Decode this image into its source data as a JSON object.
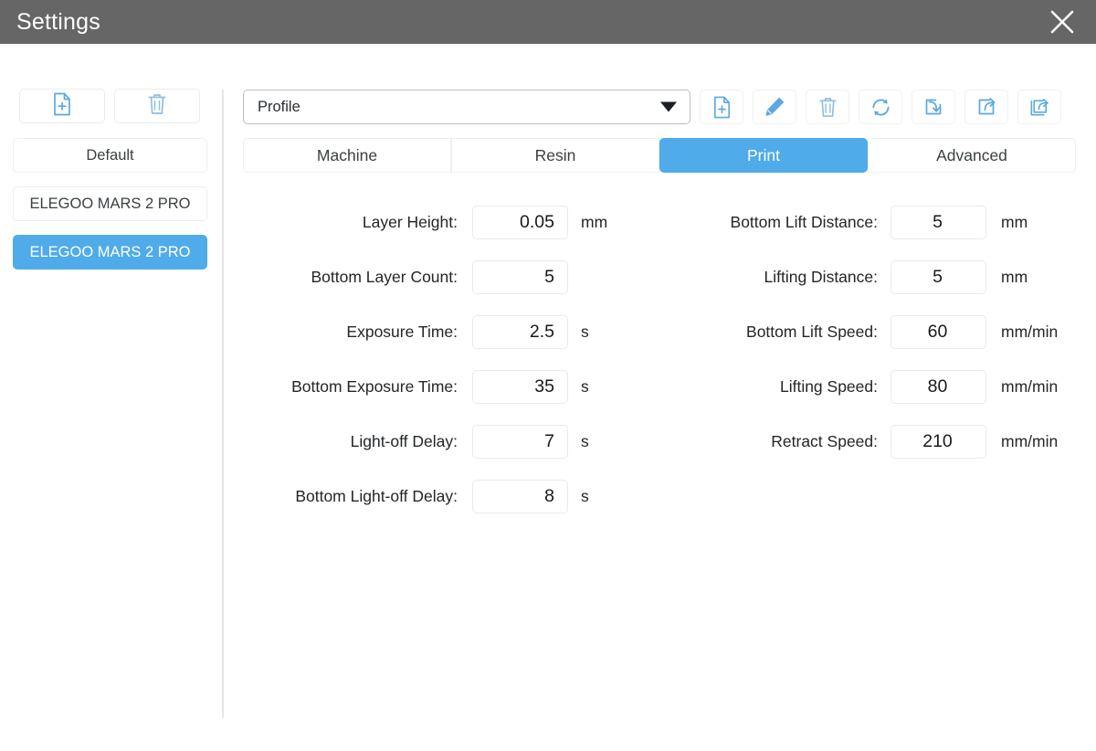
{
  "window": {
    "title": "Settings",
    "close_icon": "close-icon",
    "accent_color": "#4fabe9",
    "titlebar_color": "#666666"
  },
  "sidebar": {
    "toolbar": [
      {
        "name": "new-profile-button",
        "icon": "file-plus-icon"
      },
      {
        "name": "delete-profile-button",
        "icon": "trash-icon"
      }
    ],
    "profiles": [
      {
        "label": "Default",
        "selected": false
      },
      {
        "label": "ELEGOO MARS 2 PRO",
        "selected": false
      },
      {
        "label": "ELEGOO MARS 2 PRO",
        "selected": true
      }
    ]
  },
  "topbar": {
    "profile_select": {
      "value": "Profile",
      "caret_icon": "chevron-down-icon"
    },
    "buttons": [
      {
        "name": "new-file-button",
        "icon": "file-plus-icon"
      },
      {
        "name": "edit-button",
        "icon": "pencil-icon"
      },
      {
        "name": "delete-button",
        "icon": "trash-icon"
      },
      {
        "name": "refresh-button",
        "icon": "refresh-icon"
      },
      {
        "name": "import-button",
        "icon": "import-arrow-into-box-icon"
      },
      {
        "name": "export-button",
        "icon": "export-arrow-out-of-box-icon"
      },
      {
        "name": "export-all-button",
        "icon": "export-multiple-icon"
      }
    ]
  },
  "tabs": [
    {
      "label": "Machine",
      "active": false
    },
    {
      "label": "Resin",
      "active": false
    },
    {
      "label": "Print",
      "active": true
    },
    {
      "label": "Advanced",
      "active": false
    }
  ],
  "form": {
    "left_column": [
      {
        "label": "Layer Height:",
        "value": "0.05",
        "unit": "mm"
      },
      {
        "label": "Bottom Layer Count:",
        "value": "5",
        "unit": ""
      },
      {
        "label": "Exposure Time:",
        "value": "2.5",
        "unit": "s"
      },
      {
        "label": "Bottom Exposure Time:",
        "value": "35",
        "unit": "s"
      },
      {
        "label": "Light-off Delay:",
        "value": "7",
        "unit": "s"
      },
      {
        "label": "Bottom Light-off Delay:",
        "value": "8",
        "unit": "s"
      }
    ],
    "right_column": [
      {
        "label": "Bottom Lift Distance:",
        "value": "5",
        "unit": "mm"
      },
      {
        "label": "Lifting Distance:",
        "value": "5",
        "unit": "mm"
      },
      {
        "label": "Bottom Lift Speed:",
        "value": "60",
        "unit": "mm/min"
      },
      {
        "label": "Lifting Speed:",
        "value": "80",
        "unit": "mm/min"
      },
      {
        "label": "Retract Speed:",
        "value": "210",
        "unit": "mm/min"
      }
    ]
  }
}
